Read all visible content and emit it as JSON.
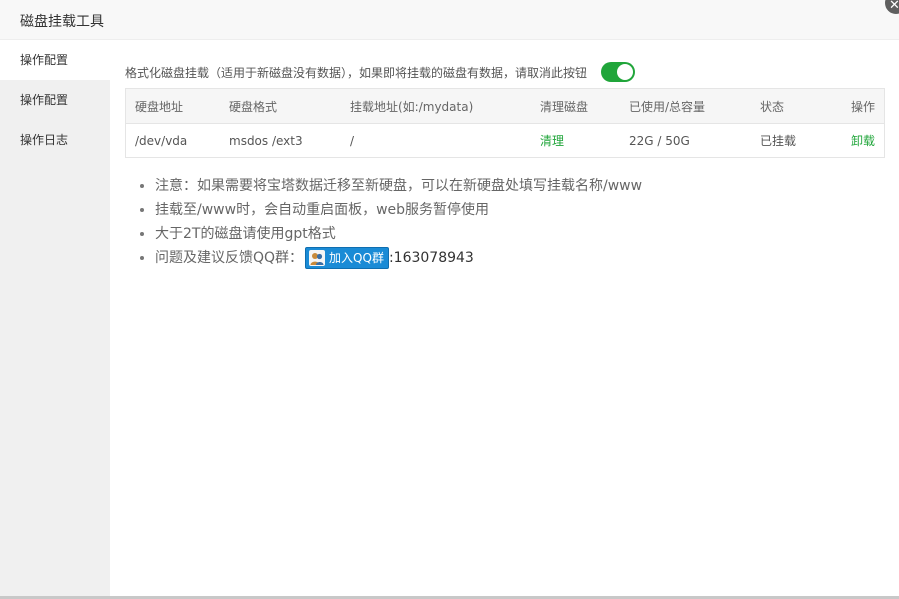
{
  "dialog": {
    "title": "磁盘挂载工具",
    "close_icon": "close-icon"
  },
  "sidebar": {
    "items": [
      {
        "label": "操作配置"
      },
      {
        "label": "操作配置"
      },
      {
        "label": "操作日志"
      }
    ]
  },
  "format": {
    "hint": "格式化磁盘挂载（适用于新磁盘没有数据），如果即将挂载的磁盘有数据，请取消此按钮",
    "toggle_on": true
  },
  "table": {
    "headers": [
      "硬盘地址",
      "硬盘格式",
      "挂载地址(如:/mydata)",
      "清理磁盘",
      "已使用/总容量",
      "状态",
      "操作"
    ],
    "rows": [
      {
        "address": "/dev/vda",
        "format": "msdos /ext3",
        "mount": "/",
        "clean": "清理",
        "usage": "22G / 50G",
        "status": "已挂载",
        "action": "卸载"
      }
    ]
  },
  "notes": {
    "items": [
      "注意：如果需要将宝塔数据迁移至新硬盘，可以在新硬盘处填写挂载名称/www",
      "挂载至/www时，会自动重启面板，web服务暂停使用",
      "大于2T的磁盘请使用gpt格式"
    ],
    "feedback_prefix": "问题及建议反馈QQ群：",
    "qq_button_label": "加入QQ群",
    "qq_number": ":163078943"
  },
  "colors": {
    "accent_green": "#20a53a",
    "qq_blue": "#1a8bd6"
  }
}
